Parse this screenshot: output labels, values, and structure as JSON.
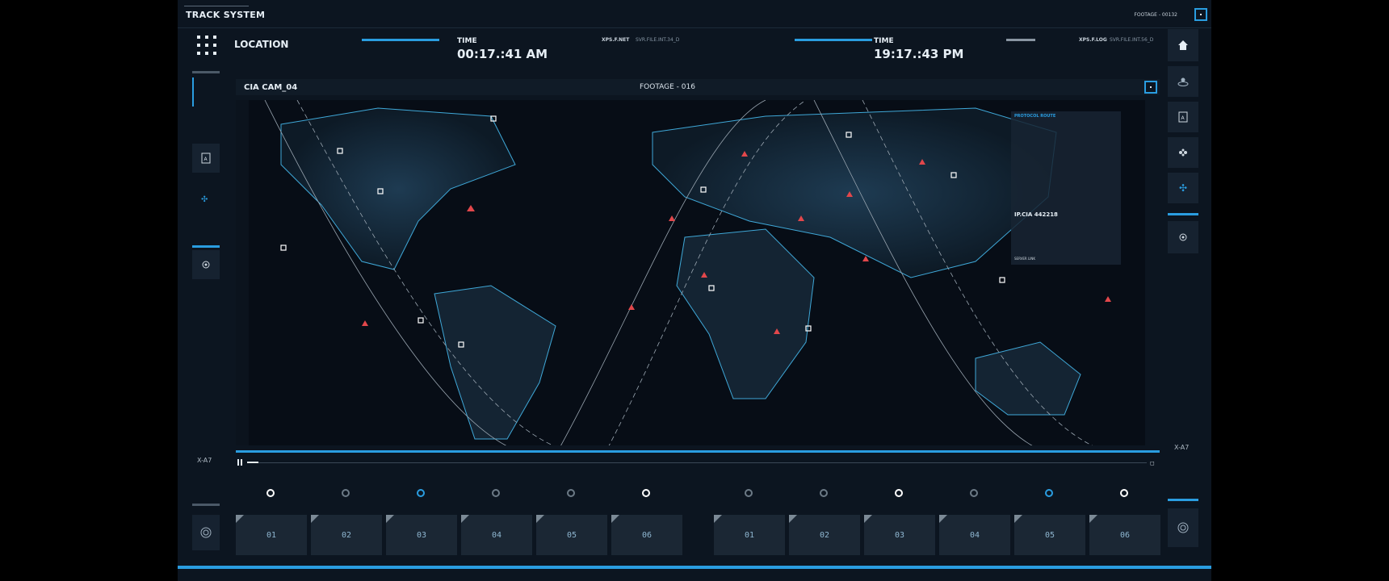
{
  "app": {
    "title": "TRACK SYSTEM",
    "footage_code": "FOOTAGE - 00132"
  },
  "header": {
    "location_label": "LOCATION",
    "time_left": {
      "label": "TIME",
      "value": "00:17.:41 AM",
      "net": "XPS.F.NET",
      "file": "SVR.FILE.INT.34_D"
    },
    "time_right": {
      "label": "TIME",
      "value": "19:17.:43 PM",
      "net": "XPS.F.LOG",
      "file": "SVR.FILE.INT.56_D"
    }
  },
  "map_view": {
    "camera": "CIA CAM_04",
    "footage": "FOOTAGE -  016",
    "overlay": {
      "title": "PROTOCOL ROUTE",
      "ip": "IP.CIA  442218",
      "server_link": "SERVER LINK"
    }
  },
  "left_col": {
    "label": "X-A7"
  },
  "right_col": {
    "label": "X-A7"
  },
  "cameras_left": [
    "01",
    "02",
    "03",
    "04",
    "05",
    "06"
  ],
  "cameras_right": [
    "01",
    "02",
    "03",
    "04",
    "05",
    "06"
  ],
  "indicators_left": [
    "white",
    "gray",
    "blue",
    "gray",
    "gray",
    "white"
  ],
  "indicators_right": [
    "gray",
    "gray",
    "white",
    "gray",
    "blue",
    "white"
  ],
  "colors": {
    "accent": "#2a9de0",
    "panel": "#162230",
    "background": "#0c1520",
    "marker": "#e2474b"
  },
  "icons": {
    "home": "home-icon",
    "location": "location-pin-icon",
    "doc": "document-icon",
    "gamepad": "gamepad-icon",
    "move": "move-icon",
    "target": "target-icon"
  }
}
